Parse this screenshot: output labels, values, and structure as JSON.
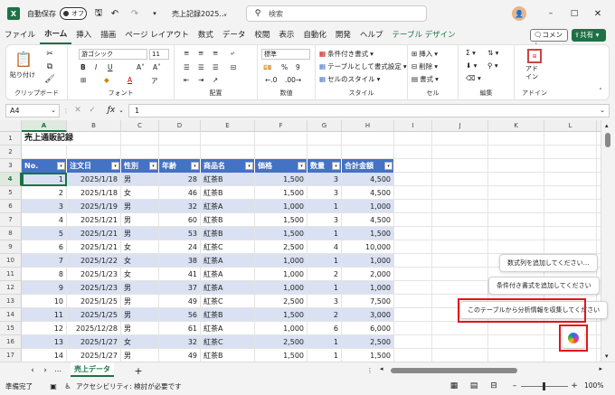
{
  "title_bar": {
    "autosave_label": "自動保存",
    "autosave_state": "オフ",
    "doc_title": "売上記録2025…",
    "search_placeholder": "検索"
  },
  "menu": [
    "ファイル",
    "ホーム",
    "挿入",
    "描画",
    "ページ レイアウト",
    "数式",
    "データ",
    "校閲",
    "表示",
    "自動化",
    "開発",
    "ヘルプ",
    "テーブル デザイン"
  ],
  "menu_right": {
    "comment": "コメント",
    "share": "共有"
  },
  "ribbon": {
    "clipboard": {
      "paste": "貼り付け",
      "label": "クリップボード"
    },
    "font": {
      "name": "游ゴシック",
      "size": "11",
      "label": "フォント"
    },
    "alignment": {
      "label": "配置"
    },
    "number": {
      "format": "標準",
      "label": "数値"
    },
    "styles": {
      "conditional": "条件付き書式",
      "table": "テーブルとして書式設定",
      "cell": "セルのスタイル",
      "label": "スタイル"
    },
    "cells": {
      "insert": "挿入",
      "delete": "削除",
      "format": "書式",
      "label": "セル"
    },
    "editing": {
      "label": "編集"
    },
    "addins": {
      "btn": "アド\nイン",
      "label": "アドイン"
    }
  },
  "formula_bar": {
    "name_box": "A4",
    "value": "1"
  },
  "columns": [
    "A",
    "B",
    "C",
    "D",
    "E",
    "F",
    "G",
    "H",
    "I",
    "J",
    "K",
    "L",
    "M"
  ],
  "sheet_title": "売上通販記録",
  "table_headers": [
    "No.",
    "注文日",
    "性別",
    "年齢",
    "商品名",
    "価格",
    "数量",
    "合計金額"
  ],
  "rows": [
    [
      "1",
      "2025/1/18",
      "男",
      "28",
      "紅茶B",
      "1,500",
      "3",
      "4,500"
    ],
    [
      "2",
      "2025/1/18",
      "女",
      "46",
      "紅茶B",
      "1,500",
      "3",
      "4,500"
    ],
    [
      "3",
      "2025/1/19",
      "男",
      "32",
      "紅茶A",
      "1,000",
      "1",
      "1,000"
    ],
    [
      "4",
      "2025/1/21",
      "男",
      "60",
      "紅茶B",
      "1,500",
      "3",
      "4,500"
    ],
    [
      "5",
      "2025/1/21",
      "男",
      "53",
      "紅茶B",
      "1,500",
      "1",
      "1,500"
    ],
    [
      "6",
      "2025/1/21",
      "女",
      "24",
      "紅茶C",
      "2,500",
      "4",
      "10,000"
    ],
    [
      "7",
      "2025/1/22",
      "女",
      "38",
      "紅茶A",
      "1,000",
      "1",
      "1,000"
    ],
    [
      "8",
      "2025/1/23",
      "女",
      "41",
      "紅茶A",
      "1,000",
      "2",
      "2,000"
    ],
    [
      "9",
      "2025/1/23",
      "男",
      "37",
      "紅茶A",
      "1,000",
      "1",
      "1,000"
    ],
    [
      "10",
      "2025/1/25",
      "男",
      "49",
      "紅茶C",
      "2,500",
      "3",
      "7,500"
    ],
    [
      "11",
      "2025/1/25",
      "男",
      "56",
      "紅茶B",
      "1,500",
      "2",
      "3,000"
    ],
    [
      "12",
      "2025/12/28",
      "男",
      "61",
      "紅茶A",
      "1,000",
      "6",
      "6,000"
    ],
    [
      "13",
      "2025/1/27",
      "女",
      "32",
      "紅茶C",
      "2,500",
      "1",
      "2,500"
    ],
    [
      "14",
      "2025/1/27",
      "男",
      "49",
      "紅茶B",
      "1,500",
      "1",
      "1,500"
    ]
  ],
  "row_numbers": [
    "1",
    "2",
    "3",
    "4",
    "5",
    "6",
    "7",
    "8",
    "9",
    "10",
    "11",
    "12",
    "13",
    "14",
    "15",
    "16",
    "17"
  ],
  "copilot": {
    "suggestion1": "数式列を追加してください…",
    "suggestion2": "条件付き書式を追加してください",
    "suggestion3": "このテーブルから分析情報を収集してください"
  },
  "sheet_tab": "売上データ",
  "status": {
    "ready": "準備完了",
    "accessibility": "アクセシビリティ: 検討が必要です",
    "zoom": "100%"
  },
  "colors": {
    "excel_green": "#1e7145",
    "table_header": "#4472c4",
    "band": "#d9e1f2",
    "highlight": "#e0141e"
  }
}
